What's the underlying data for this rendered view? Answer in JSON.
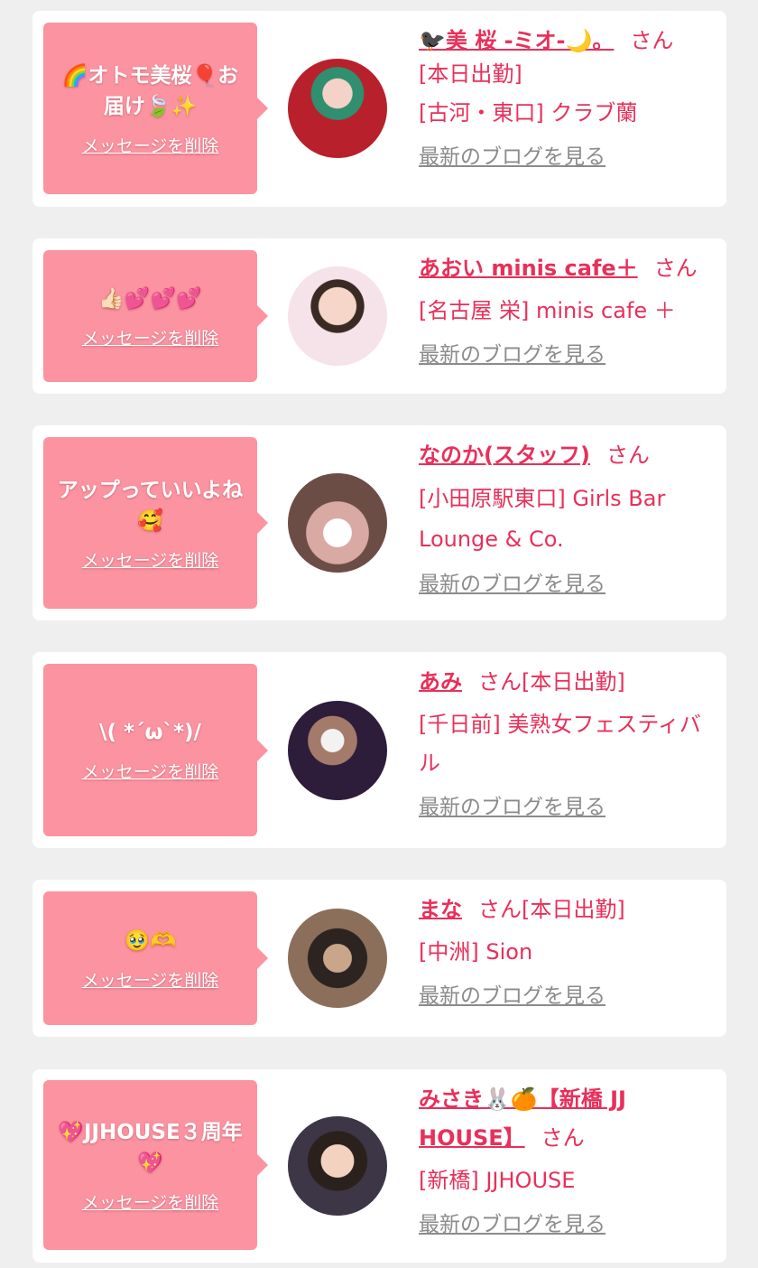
{
  "colors": {
    "accent": "#e8305a",
    "bubble": "#fb93a1",
    "page_bg": "#efefef",
    "card_bg": "#ffffff",
    "muted": "#8b8b8b"
  },
  "delete_label": "メッセージを削除",
  "blog_label": "最新のブログを見る",
  "honorific": "さん",
  "items": [
    {
      "message": "🌈オトモ美桜🎈お届け🍃✨",
      "name": "🐦‍⬛美 桜 -ミオ-🌙。",
      "suffix": "[本日出勤]",
      "shop": "[古河・東口] クラブ蘭",
      "avatar_icon": "user-avatar"
    },
    {
      "message": "👍🏻💕💕💕",
      "name": "あおい minis cafe＋",
      "suffix": "",
      "shop": "[名古屋 栄] minis cafe ＋",
      "avatar_icon": "user-avatar"
    },
    {
      "message": "アップっていいよね🥰",
      "name": "なのか(スタッフ)",
      "suffix": "",
      "shop": "[小田原駅東口] Girls Bar Lounge & Co.",
      "avatar_icon": "user-avatar"
    },
    {
      "message": "\\( *´ω`*)/",
      "name": "あみ",
      "suffix": "[本日出勤]",
      "shop": "[千日前] 美熟女フェスティバル",
      "avatar_icon": "user-avatar"
    },
    {
      "message": "🥹🫶",
      "name": "まな",
      "suffix": "[本日出勤]",
      "shop": "[中洲] Sion",
      "avatar_icon": "user-avatar"
    },
    {
      "message": "💖JJHOUSE３周年💖",
      "name": "みさき🐰🍊【新橋 JJ HOUSE】",
      "suffix": "",
      "shop": "[新橋] JJHOUSE",
      "avatar_icon": "user-avatar"
    }
  ]
}
